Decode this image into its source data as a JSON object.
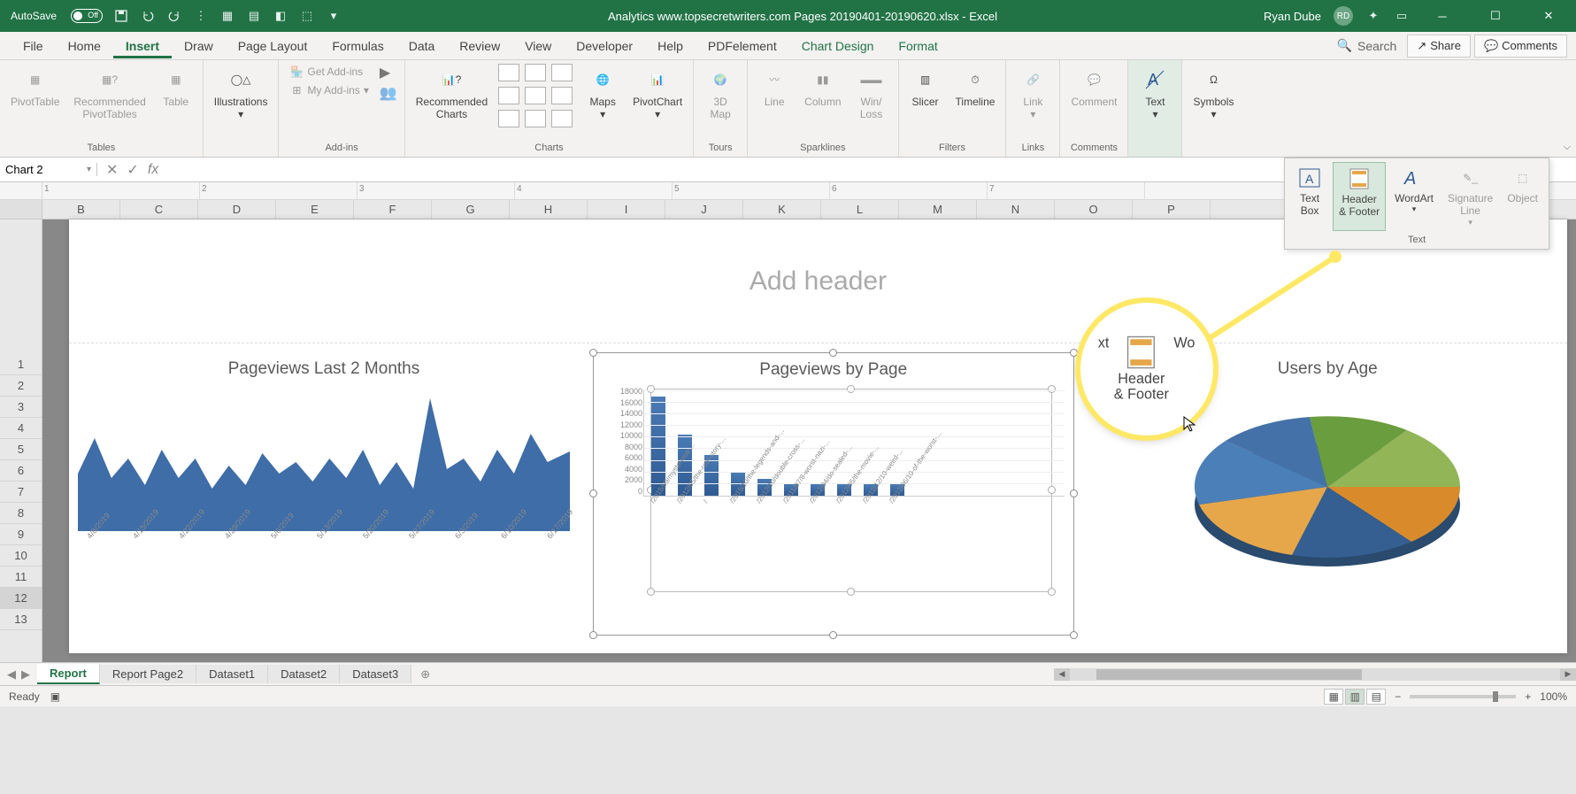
{
  "titlebar": {
    "autosave_label": "AutoSave",
    "autosave_state": "Off",
    "document_title": "Analytics www.topsecretwriters.com Pages 20190401-20190620.xlsx - Excel",
    "user_name": "Ryan Dube",
    "user_initials": "RD"
  },
  "ribbon_tabs": {
    "file": "File",
    "home": "Home",
    "insert": "Insert",
    "draw": "Draw",
    "page_layout": "Page Layout",
    "formulas": "Formulas",
    "data": "Data",
    "review": "Review",
    "view": "View",
    "developer": "Developer",
    "help": "Help",
    "pdfelement": "PDFelement",
    "chart_design": "Chart Design",
    "format": "Format",
    "search_placeholder": "Search",
    "share": "Share",
    "comments": "Comments"
  },
  "ribbon": {
    "tables": {
      "pivottable": "PivotTable",
      "rec_pivot": "Recommended\nPivotTables",
      "table": "Table",
      "label": "Tables"
    },
    "illustrations": {
      "button": "Illustrations",
      "label": ""
    },
    "addins": {
      "get": "Get Add-ins",
      "my": "My Add-ins",
      "label": "Add-ins"
    },
    "charts": {
      "recommended": "Recommended\nCharts",
      "maps": "Maps",
      "pivotchart": "PivotChart",
      "label": "Charts"
    },
    "tours": {
      "map3d": "3D\nMap",
      "label": "Tours"
    },
    "sparklines": {
      "line": "Line",
      "column": "Column",
      "winloss": "Win/\nLoss",
      "label": "Sparklines"
    },
    "filters": {
      "slicer": "Slicer",
      "timeline": "Timeline",
      "label": "Filters"
    },
    "links": {
      "link": "Link",
      "label": "Links"
    },
    "comments": {
      "comment": "Comment",
      "label": "Comments"
    },
    "text": {
      "text": "Text",
      "label": ""
    },
    "symbols": {
      "symbols": "Symbols",
      "label": ""
    }
  },
  "text_panel": {
    "textbox": "Text\nBox",
    "header_footer": "Header\n& Footer",
    "wordart": "WordArt",
    "signature": "Signature\nLine",
    "object": "Object",
    "label": "Text"
  },
  "callout": {
    "left_partial": "xt",
    "center": "Header\n& Footer",
    "right_partial": "Wo"
  },
  "formula_bar": {
    "name_box": "Chart 2",
    "fx": "fx"
  },
  "columns": [
    "B",
    "C",
    "D",
    "E",
    "F",
    "G",
    "H",
    "I",
    "J",
    "K",
    "L",
    "M",
    "N",
    "O",
    "P"
  ],
  "rows": [
    "1",
    "2",
    "3",
    "4",
    "5",
    "6",
    "7",
    "8",
    "9",
    "10",
    "11",
    "12",
    "13"
  ],
  "page": {
    "header_placeholder": "Add header"
  },
  "chart1": {
    "title": "Pageviews Last 2 Months",
    "xlabels": [
      "4/8/2019",
      "4/15/2019",
      "4/22/2019",
      "4/29/2019",
      "5/6/2019",
      "5/13/2019",
      "5/20/2019",
      "5/27/2019",
      "6/3/2019",
      "6/10/2019",
      "6/17/2019"
    ]
  },
  "chart2": {
    "title": "Pageviews by Page",
    "ylabels": [
      "18000",
      "16000",
      "14000",
      "12000",
      "10000",
      "8000",
      "6000",
      "4000",
      "2000",
      "0"
    ],
    "xlabels": [
      "/2015/09/mysterious-...",
      "/2012/05/the-real-story-...",
      "/",
      "/2015/10/the-legends-and-...",
      "/2012/10/double-cross-...",
      "/2011/07/8-worst-nazi-...",
      "/2012/04/do-sealed-...",
      "/2012/05/the-movie-...",
      "/2012/12/10-weird-...",
      "/2012/06/10-of-the-worst-..."
    ]
  },
  "chart3": {
    "title": "Users by Age"
  },
  "chart_data": [
    {
      "type": "area",
      "title": "Pageviews Last 2 Months",
      "x": [
        "4/8/2019",
        "4/15/2019",
        "4/22/2019",
        "4/29/2019",
        "5/6/2019",
        "5/13/2019",
        "5/20/2019",
        "5/27/2019",
        "6/3/2019",
        "6/10/2019",
        "6/17/2019"
      ],
      "values_relative": [
        0.45,
        0.7,
        0.4,
        0.55,
        0.35,
        0.62,
        0.4,
        0.55,
        0.32,
        0.48,
        0.35,
        0.58,
        0.42,
        0.5,
        0.38,
        0.55,
        0.4,
        0.62,
        0.35,
        0.5,
        0.3,
        0.95,
        0.45,
        0.55,
        0.38,
        0.6,
        0.42,
        0.68,
        0.5
      ],
      "note": "values are relative heights; no y-axis shown"
    },
    {
      "type": "bar",
      "title": "Pageviews by Page",
      "categories": [
        "/2015/09/mysterious-...",
        "/2012/05/the-real-story-...",
        "/",
        "/2015/10/the-legends-and-...",
        "/2012/10/double-cross-...",
        "/2011/07/8-worst-nazi-...",
        "/2012/04/do-sealed-...",
        "/2012/05/the-movie-...",
        "/2012/12/10-weird-...",
        "/2012/06/10-of-the-worst-..."
      ],
      "values": [
        17000,
        10500,
        7000,
        4000,
        2800,
        2200,
        2200,
        2000,
        2000,
        2000
      ],
      "ylim": [
        0,
        18000
      ],
      "ylabel": "",
      "xlabel": ""
    },
    {
      "type": "pie",
      "title": "Users by Age",
      "slices_percent": [
        12,
        14,
        18,
        22,
        18,
        10,
        6
      ],
      "colors": [
        "#4472a8",
        "#6a9d3d",
        "#d98b2b",
        "#355f91",
        "#4b7fb8",
        "#92b557",
        "#e6a74a"
      ],
      "note": "legend/labels not visible in crop"
    }
  ],
  "sheet_tabs": {
    "tabs": [
      "Report",
      "Report Page2",
      "Dataset1",
      "Dataset2",
      "Dataset3"
    ]
  },
  "statusbar": {
    "ready": "Ready",
    "zoom": "100%"
  }
}
